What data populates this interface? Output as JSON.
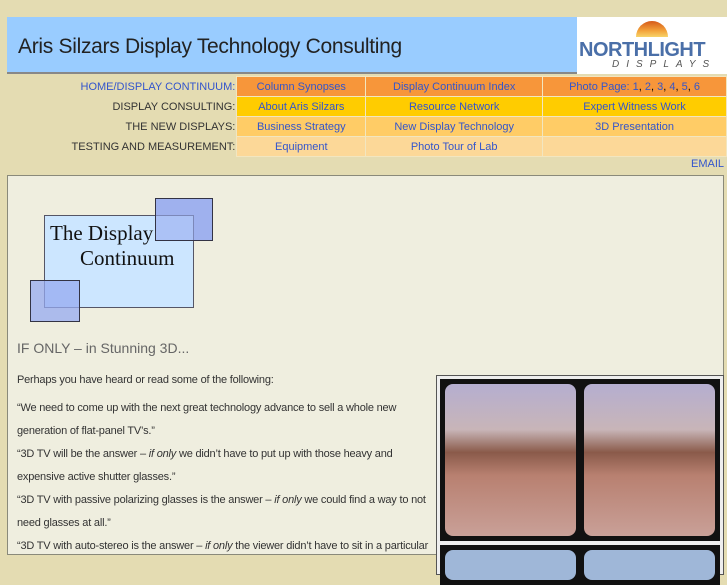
{
  "header": {
    "title": "Aris Silzars Display Technology Consulting",
    "logo_text": "NORTHLIGHT",
    "logo_sub": "DISPLAYS"
  },
  "nav": [
    {
      "label": "HOME/DISPLAY CONTINUUM:",
      "label_link": true,
      "links": [
        "Column Synopses",
        "Display Continuum Index"
      ],
      "photo_prefix": "Photo Page: ",
      "photo_pages": [
        "1",
        "2",
        "3",
        "4",
        "5",
        "6"
      ]
    },
    {
      "label": "DISPLAY CONSULTING:",
      "links": [
        "About Aris Silzars",
        "Resource Network",
        "Expert Witness Work"
      ]
    },
    {
      "label": "THE NEW DISPLAYS:",
      "links": [
        "Business Strategy",
        "New Display Technology",
        "3D Presentation"
      ]
    },
    {
      "label": "TESTING AND MEASUREMENT:",
      "links": [
        "Equipment",
        "Photo Tour of Lab"
      ]
    }
  ],
  "email": "EMAIL",
  "content": {
    "logo_line1": "The Display",
    "logo_line2": "Continuum",
    "heading": "IF ONLY – in Stunning 3D...",
    "intro": "Perhaps you have heard or read some of the following:",
    "q1": "“We need to come up with the next great technology advance to sell a whole new generation of flat-panel TV’s.”",
    "q2a": "“3D TV will be the answer – ",
    "q2b": "if only",
    "q2c": " we didn’t have to put up with those heavy and expensive active shutter glasses.”",
    "q3a": "“3D TV with passive polarizing glasses is the answer – ",
    "q3b": "if only",
    "q3c": " we could find a way to not need glasses at all.”",
    "q4a": "“3D TV with auto-stereo is the answer – ",
    "q4b": "if only",
    "q4c": " the viewer didn’t have to sit in a particular"
  }
}
